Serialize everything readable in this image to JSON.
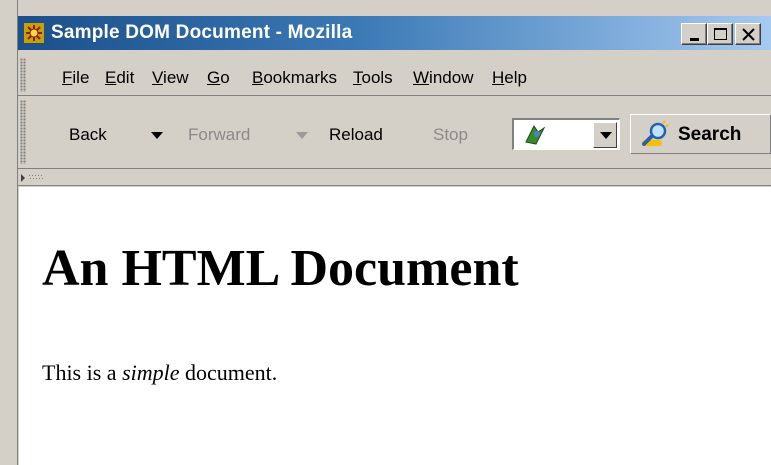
{
  "window": {
    "title": "Sample DOM Document - Mozilla",
    "controls": [
      "minimize",
      "maximize",
      "close"
    ]
  },
  "menu": {
    "items": [
      {
        "label": "File",
        "accel": "F",
        "rest": "ile"
      },
      {
        "label": "Edit",
        "accel": "E",
        "rest": "dit"
      },
      {
        "label": "View",
        "accel": "V",
        "rest": "iew"
      },
      {
        "label": "Go",
        "accel": "G",
        "rest": "o"
      },
      {
        "label": "Bookmarks",
        "accel": "B",
        "rest": "ookmarks"
      },
      {
        "label": "Tools",
        "accel": "T",
        "rest": "ools"
      },
      {
        "label": "Window",
        "accel": "W",
        "rest": "indow"
      },
      {
        "label": "Help",
        "accel": "H",
        "rest": "elp"
      }
    ]
  },
  "nav": {
    "back": "Back",
    "forward": "Forward",
    "reload": "Reload",
    "stop": "Stop",
    "search": "Search",
    "address_value": ""
  },
  "colors": {
    "title_gradient_start": "#1b4f8a",
    "title_gradient_end": "#a6caf0",
    "chrome": "#d4d0c8",
    "disabled_text": "#8a8a8a"
  },
  "page": {
    "heading": "An HTML Document",
    "para_prefix": "This is a ",
    "para_emphasis": "simple",
    "para_suffix": " document."
  }
}
